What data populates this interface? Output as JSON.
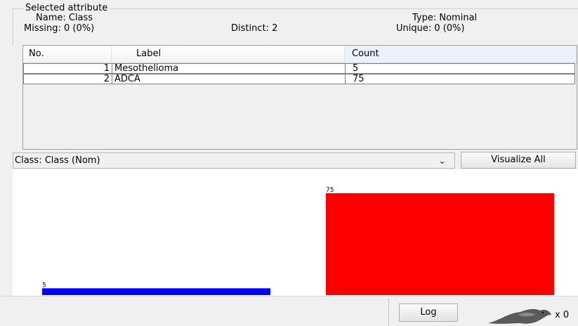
{
  "selected_attribute": {
    "legend": "Selected attribute",
    "name_label": "Name: Class",
    "missing_label": "Missing: 0 (0%)",
    "distinct_label": "Distinct: 2",
    "type_label": "Type: Nominal",
    "unique_label": "Unique: 0 (0%)"
  },
  "table": {
    "headers": [
      "No.",
      "Label",
      "Count"
    ],
    "rows": [
      {
        "no": "1",
        "label": "Mesothelioma",
        "count": "5"
      },
      {
        "no": "2",
        "label": "ADCA",
        "count": "75"
      }
    ]
  },
  "class_select": {
    "value": "Class: Class (Nom)",
    "chevron": "⌄"
  },
  "visualize_button": "Visualize All",
  "log_button": "Log",
  "status_count": "x 0",
  "colors": {
    "mesothelioma": "#0000ff",
    "adca": "#ff0000"
  },
  "chart_data": {
    "type": "bar",
    "categories": [
      "Mesothelioma",
      "ADCA"
    ],
    "values": [
      5,
      75
    ],
    "data_labels": [
      "5",
      "75"
    ],
    "ylim": [
      0,
      75
    ]
  }
}
